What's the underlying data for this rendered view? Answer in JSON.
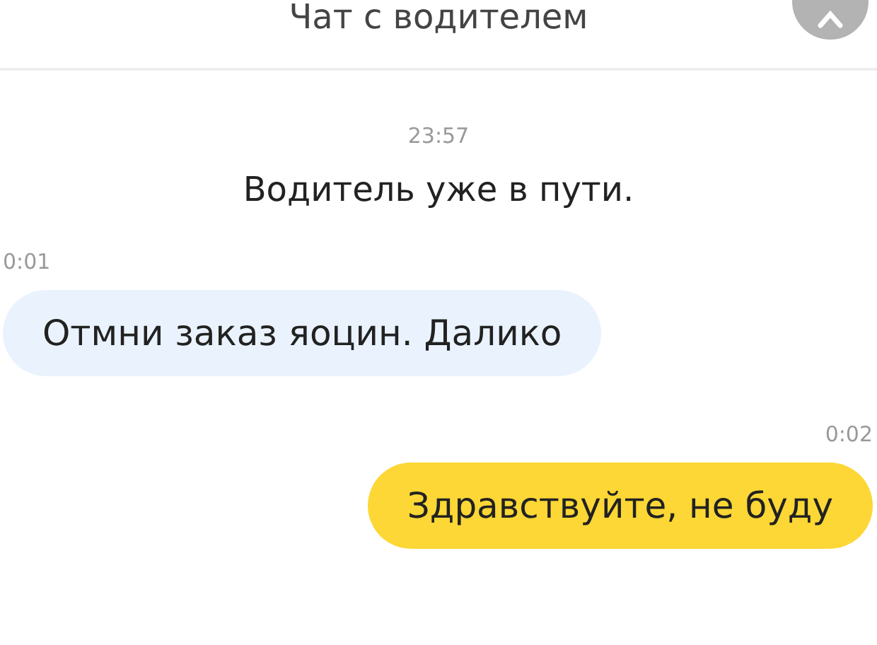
{
  "header": {
    "title": "Чат с водителем"
  },
  "messages": [
    {
      "kind": "system",
      "time": "23:57",
      "text": "Водитель уже в пути."
    },
    {
      "kind": "incoming",
      "time": "0:01",
      "text": "Отмни заказ яоцин. Далико"
    },
    {
      "kind": "outgoing",
      "time": "0:02",
      "text": "Здравствуйте, не буду"
    }
  ]
}
